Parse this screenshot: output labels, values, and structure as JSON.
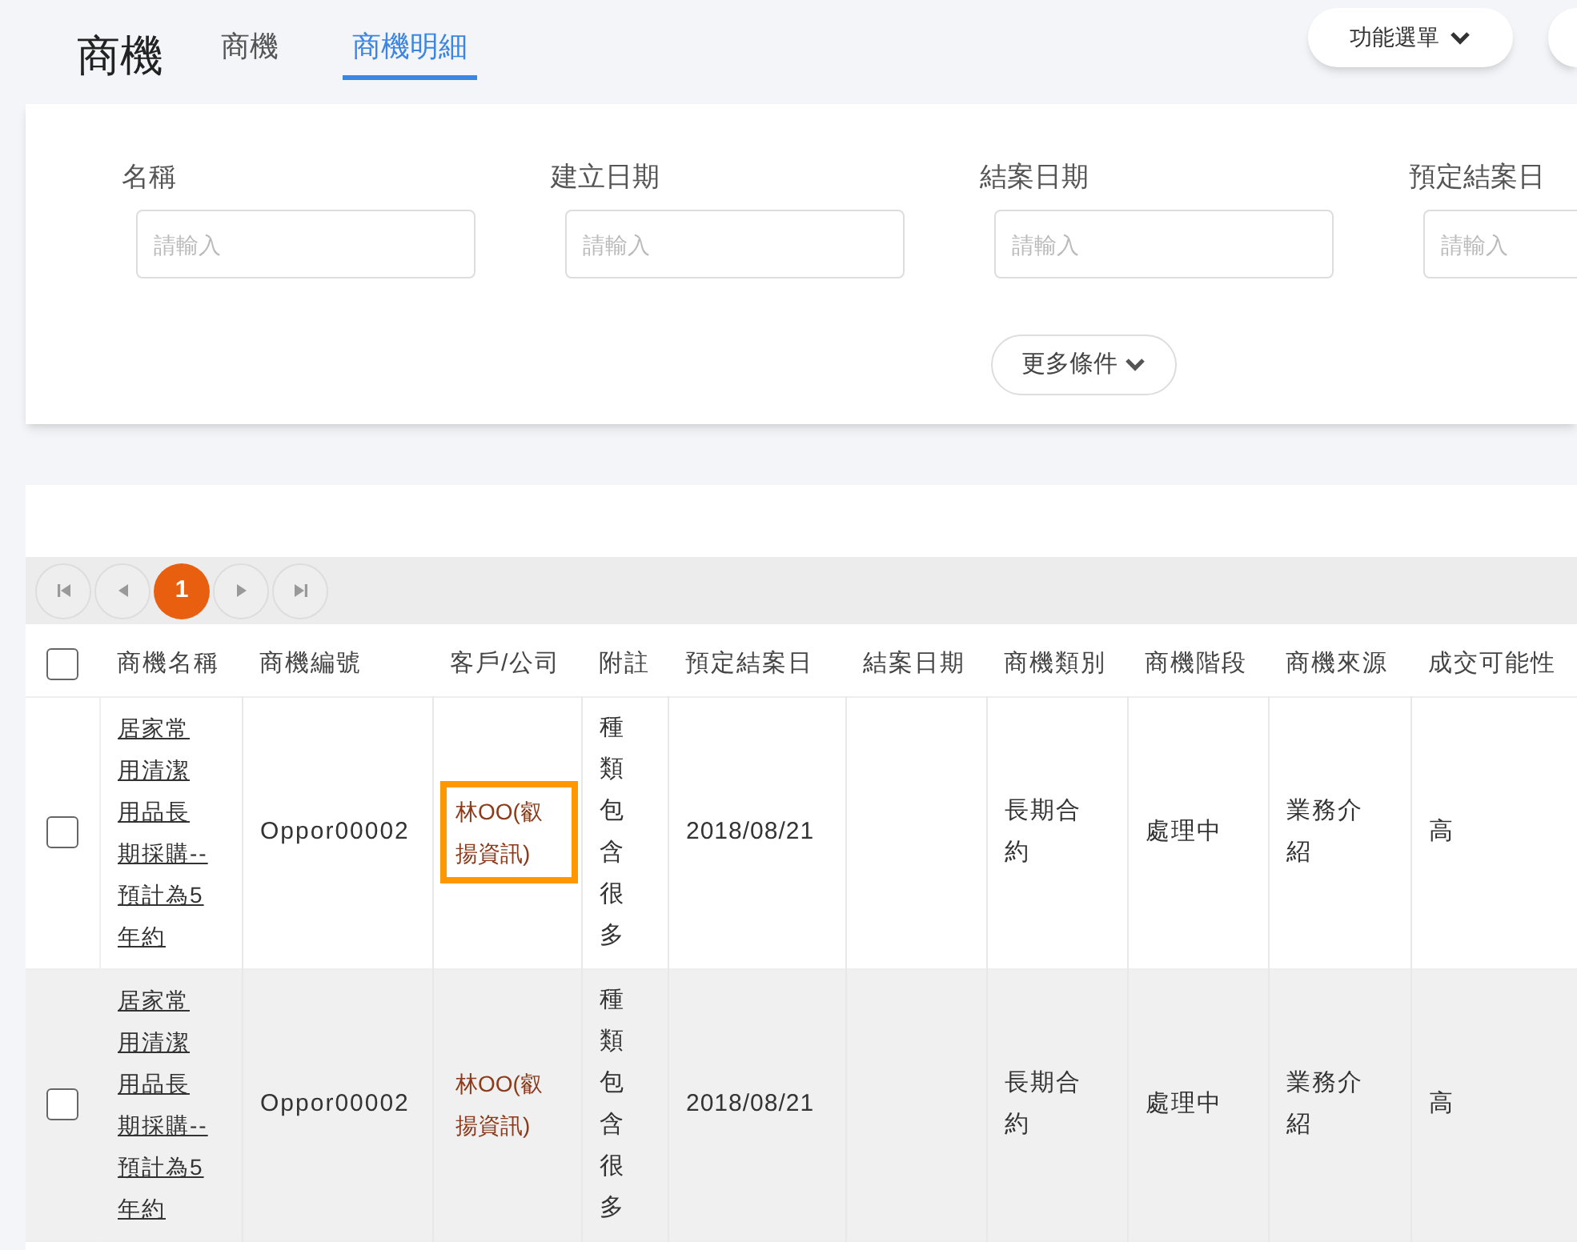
{
  "page_title": "商機",
  "tabs": [
    {
      "label": "商機",
      "selected": false
    },
    {
      "label": "商機明細",
      "selected": true
    }
  ],
  "menu_button": {
    "label": "功能選單"
  },
  "filters": [
    {
      "label": "名稱",
      "placeholder": "請輸入"
    },
    {
      "label": "建立日期",
      "placeholder": "請輸入"
    },
    {
      "label": "結案日期",
      "placeholder": "請輸入"
    },
    {
      "label": "預定結案日",
      "placeholder": "請輸入"
    }
  ],
  "more_button": {
    "label": "更多條件"
  },
  "pagination": {
    "pages": [
      {
        "label": "1",
        "selected": true
      }
    ]
  },
  "table": {
    "select_all": {
      "checked": false
    },
    "columns": [
      "商機名稱",
      "商機編號",
      "客戶/公司",
      "附註",
      "預定結案日",
      "結案日期",
      "商機類別",
      "商機階段",
      "商機來源",
      "成交可能性"
    ],
    "rows": [
      {
        "checked": false,
        "shaded": false,
        "name": "居家常用清潔用品長期採購--預計為5年約",
        "number": "Oppor00002",
        "customer": "林OO(叡揚資訊)",
        "customer_outlined": true,
        "note": "種類包含很多",
        "due_date": "2018/08/21",
        "closed_date": "",
        "category": "長期合約",
        "stage": "處理中",
        "source": "業務介紹",
        "probability": "高"
      },
      {
        "checked": false,
        "shaded": true,
        "name": "居家常用清潔用品長期採購--預計為5年約",
        "number": "Oppor00002",
        "customer": "林OO(叡揚資訊)",
        "customer_outlined": false,
        "note": "種類包含很多",
        "due_date": "2018/08/21",
        "closed_date": "",
        "category": "長期合約",
        "stage": "處理中",
        "source": "業務介紹",
        "probability": "高"
      }
    ]
  }
}
